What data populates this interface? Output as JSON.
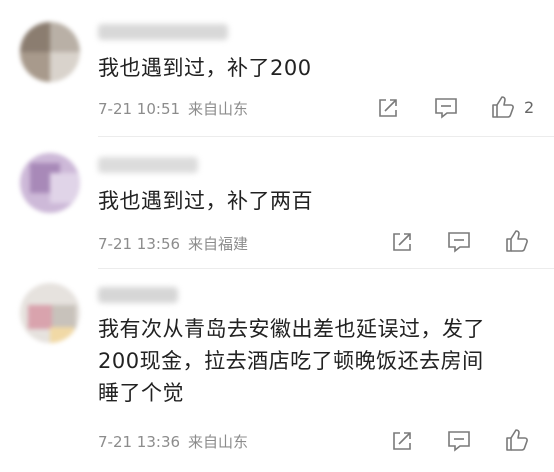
{
  "comments": [
    {
      "text": "我也遇到过，补了200",
      "date": "7-21 10:51",
      "location": "来自山东",
      "likes": "2"
    },
    {
      "text": "我也遇到过，补了两百",
      "date": "7-21 13:56",
      "location": "来自福建",
      "likes": ""
    },
    {
      "text": "我有次从青岛去安徽出差也延误过，发了200现金，拉去酒店吃了顿晚饭还去房间睡了个觉",
      "date": "7-21 13:36",
      "location": "来自山东",
      "likes": ""
    }
  ],
  "icons": {
    "share": "share-icon",
    "reply": "reply-icon",
    "like": "thumbs-up-icon"
  },
  "colors": {
    "text": "#222222",
    "meta": "#8c8c8c",
    "icon": "#7a7a7a",
    "divider": "#ececec"
  }
}
